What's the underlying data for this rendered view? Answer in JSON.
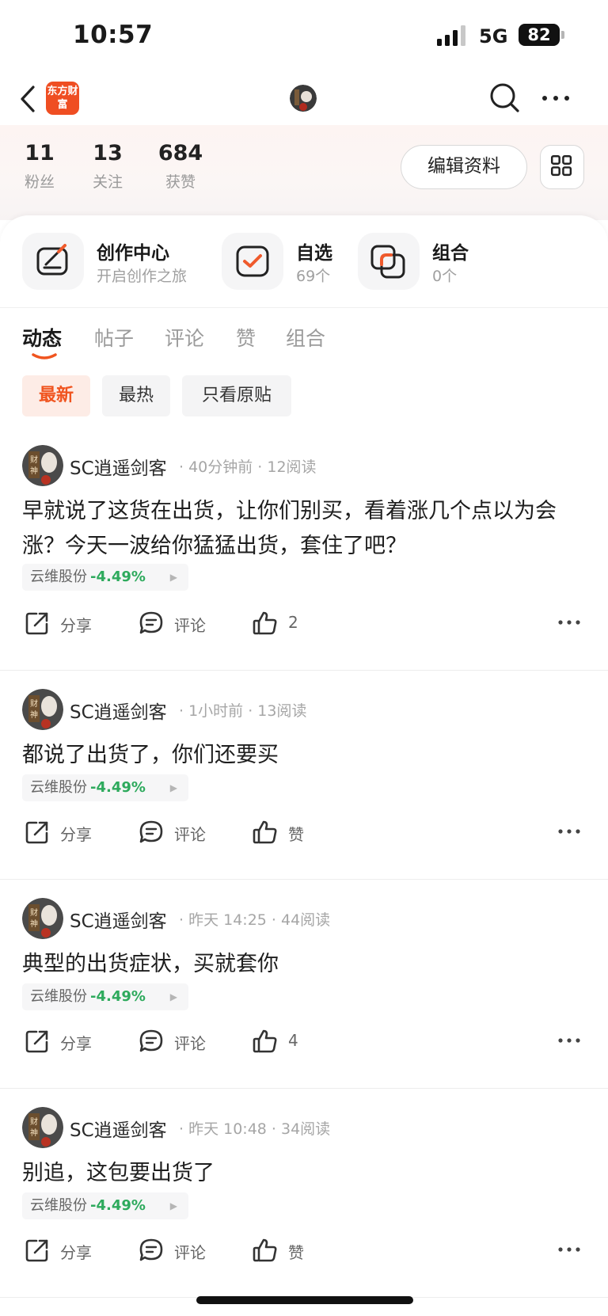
{
  "status_bar": {
    "time": "10:57",
    "network": "5G",
    "battery": "82"
  },
  "nav": {
    "logo_text": "东方财富"
  },
  "profile": {
    "stats": [
      {
        "value": "11",
        "label": "粉丝"
      },
      {
        "value": "13",
        "label": "关注"
      },
      {
        "value": "684",
        "label": "获赞"
      }
    ],
    "edit_label": "编辑资料"
  },
  "shortcuts": [
    {
      "title": "创作中心",
      "subtitle": "开启创作之旅",
      "icon": "creation-icon"
    },
    {
      "title": "自选",
      "subtitle": "69个",
      "icon": "watchlist-check-icon"
    },
    {
      "title": "组合",
      "subtitle": "0个",
      "icon": "portfolio-icon"
    }
  ],
  "tabs": [
    "动态",
    "帖子",
    "评论",
    "赞",
    "组合"
  ],
  "filters": [
    "最新",
    "最热",
    "只看原贴"
  ],
  "posts": [
    {
      "author": "SC逍遥剑客",
      "meta": "· 40分钟前 · 12阅读",
      "body": "早就说了这货在出货，让你们别买，看着涨几个点以为会涨？今天一波给你猛猛出货，套住了吧？",
      "stock": "云维股份",
      "change": "-4.49%",
      "share": "分享",
      "comment": "评论",
      "likes": "2"
    },
    {
      "author": "SC逍遥剑客",
      "meta": "· 1小时前 · 13阅读",
      "body": "都说了出货了，你们还要买",
      "stock": "云维股份",
      "change": "-4.49%",
      "share": "分享",
      "comment": "评论",
      "likes": "赞"
    },
    {
      "author": "SC逍遥剑客",
      "meta": "· 昨天 14:25 · 44阅读",
      "body": "典型的出货症状，买就套你",
      "stock": "云维股份",
      "change": "-4.49%",
      "share": "分享",
      "comment": "评论",
      "likes": "4"
    },
    {
      "author": "SC逍遥剑客",
      "meta": "· 昨天 10:48 · 34阅读",
      "body": "别追，这包要出货了",
      "stock": "云维股份",
      "change": "-4.49%",
      "share": "分享",
      "comment": "评论",
      "likes": "赞"
    }
  ],
  "colors": {
    "brand": "#ef4e22",
    "accent": "#f0541f",
    "down_green": "#2eaa5d"
  }
}
